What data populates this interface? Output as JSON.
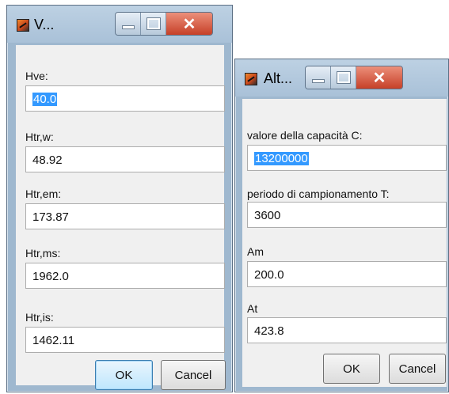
{
  "dialog1": {
    "title": "V...",
    "fields": [
      {
        "label": "Hve:",
        "value": "40.0",
        "selected": true
      },
      {
        "label": "Htr,w:",
        "value": "48.92",
        "selected": false
      },
      {
        "label": "Htr,em:",
        "value": "173.87",
        "selected": false
      },
      {
        "label": "Htr,ms:",
        "value": "1962.0",
        "selected": false
      },
      {
        "label": "Htr,is:",
        "value": "1462.11",
        "selected": false
      }
    ],
    "ok_label": "OK",
    "cancel_label": "Cancel"
  },
  "dialog2": {
    "title": "Alt...",
    "fields": [
      {
        "label": "valore della capacità C:",
        "value": "13200000",
        "selected": true
      },
      {
        "label": "periodo di campionamento T:",
        "value": "3600",
        "selected": false
      },
      {
        "label": "Am",
        "value": "200.0",
        "selected": false
      },
      {
        "label": "At",
        "value": "423.8",
        "selected": false
      }
    ],
    "ok_label": "OK",
    "cancel_label": "Cancel"
  },
  "colors": {
    "frame": "#9fb8cf",
    "close_button": "#c64028",
    "selection": "#3399ff",
    "client": "#f0f0f0"
  }
}
